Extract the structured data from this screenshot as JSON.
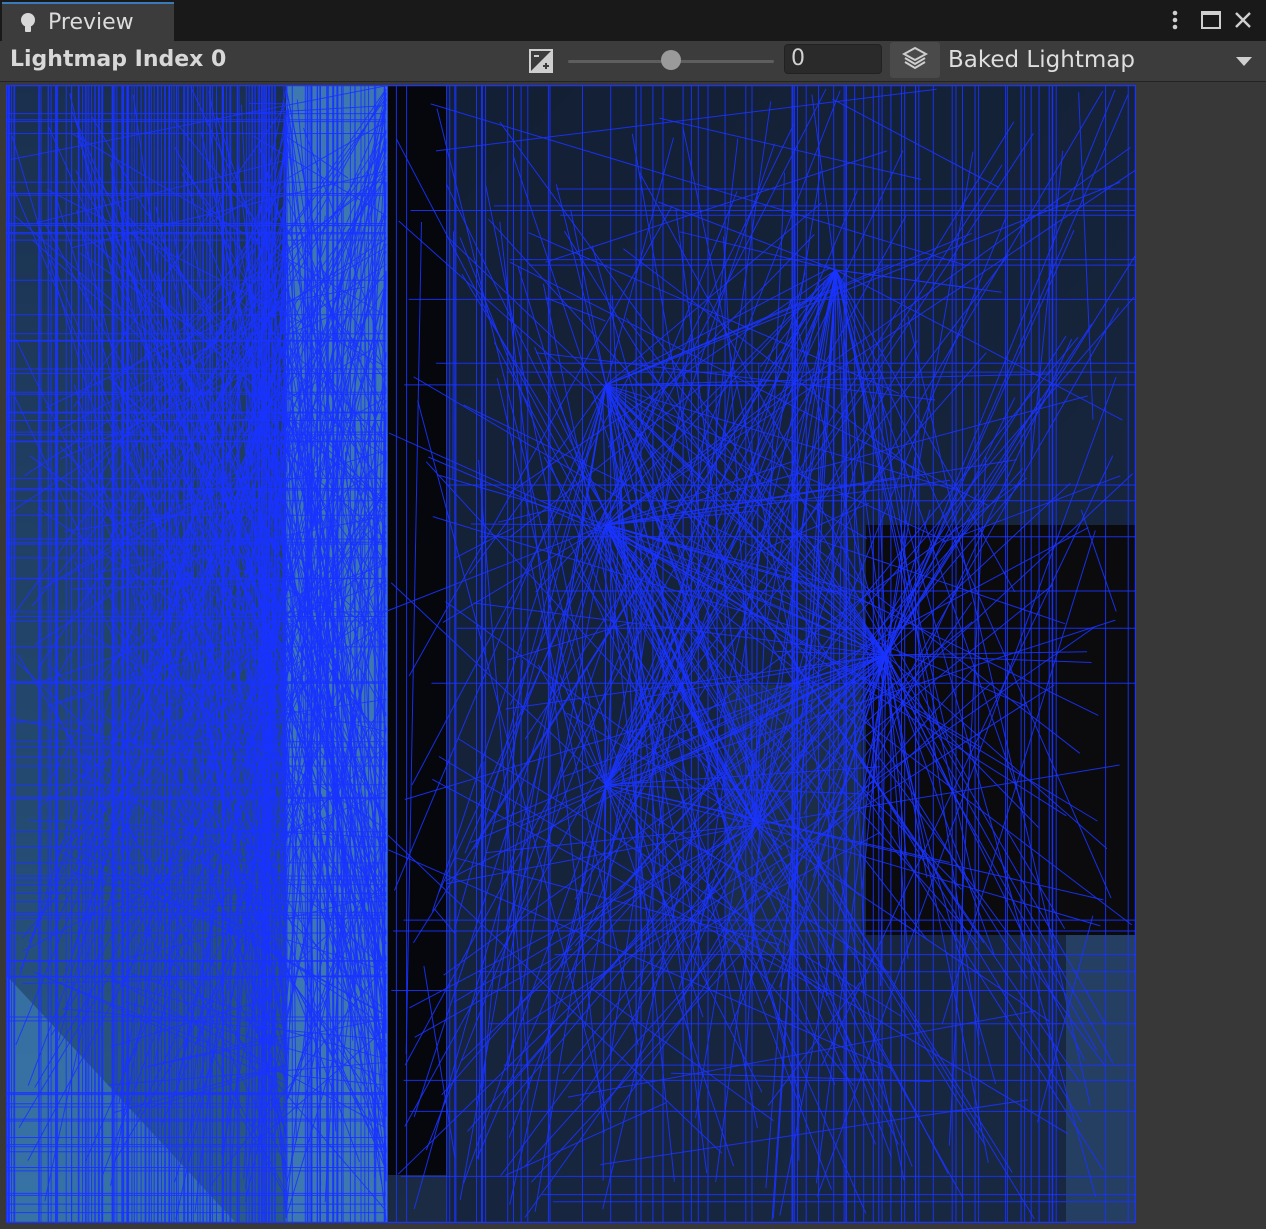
{
  "tab": {
    "label": "Preview",
    "icon": "lightbulb-icon"
  },
  "window_controls": {
    "menu_icon": "kebab-menu-icon",
    "maximize_icon": "maximize-icon",
    "close_icon": "close-icon"
  },
  "toolbar": {
    "title": "Lightmap Index 0",
    "exposure_icon": "exposure-icon",
    "exposure_slider_level": 0.5,
    "exposure_value": "0",
    "layers_icon": "layers-icon",
    "mode": "Baked Lightmap",
    "mode_caret_icon": "chevron-down-icon"
  },
  "colors": {
    "panel": "#383838",
    "tabbar": "#191919",
    "tab_accent": "#3a79bb",
    "wireframe": "#1a33ff"
  }
}
